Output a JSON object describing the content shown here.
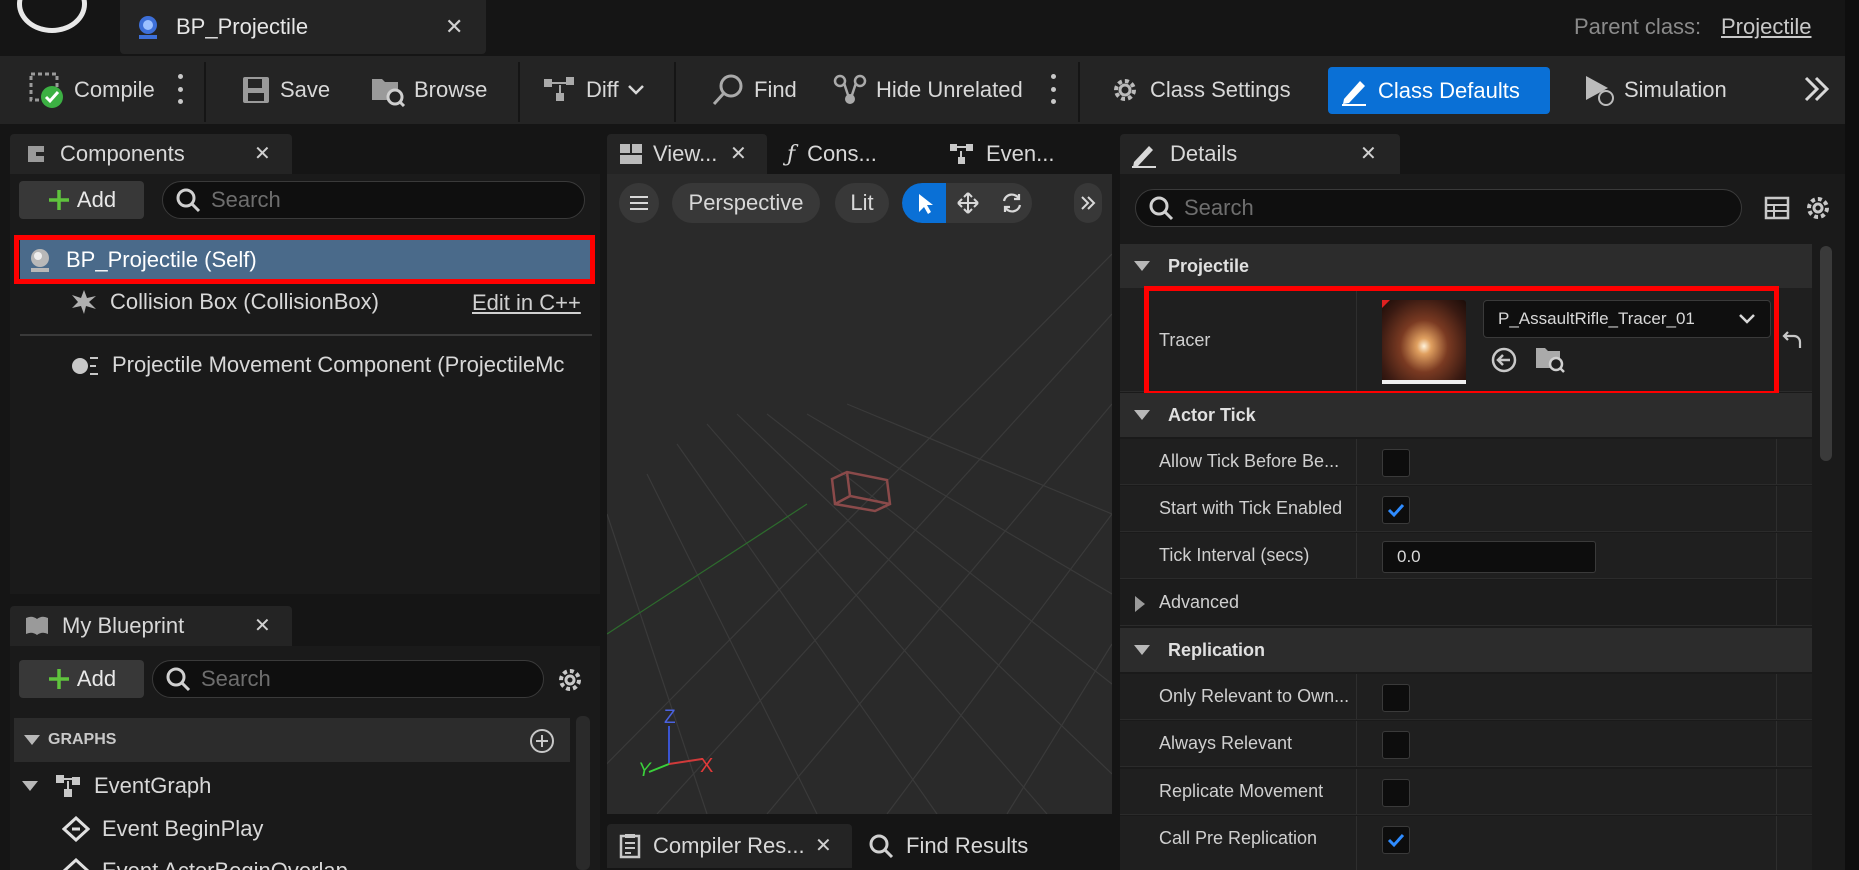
{
  "asset_tab": {
    "title": "BP_Projectile"
  },
  "parent_class": {
    "label": "Parent class:",
    "value": "Projectile"
  },
  "toolbar": {
    "compile": "Compile",
    "save": "Save",
    "browse": "Browse",
    "diff": "Diff",
    "find": "Find",
    "hide_unrelated": "Hide Unrelated",
    "class_settings": "Class Settings",
    "class_defaults": "Class Defaults",
    "simulation": "Simulation"
  },
  "components_panel": {
    "title": "Components",
    "add_label": "Add",
    "search_placeholder": "Search",
    "items": [
      {
        "label": "BP_Projectile (Self)"
      },
      {
        "label": "Collision Box (CollisionBox)",
        "action": "Edit in C++"
      },
      {
        "label": "Projectile Movement Component (ProjectileMc"
      }
    ]
  },
  "my_blueprint": {
    "title": "My Blueprint",
    "add_label": "Add",
    "search_placeholder": "Search",
    "graphs_header": "GRAPHS",
    "graph_items": [
      "EventGraph",
      "Event BeginPlay",
      "Event ActorBeginOverlap"
    ]
  },
  "center_tabs": [
    "View...",
    "Cons...",
    "Even..."
  ],
  "viewport": {
    "perspective": "Perspective",
    "lit": "Lit",
    "axis_x": "X",
    "axis_y": "Y",
    "axis_z": "Z"
  },
  "bottom_tabs": [
    "Compiler Res...",
    "Find Results"
  ],
  "details": {
    "title": "Details",
    "search_placeholder": "Search",
    "sections": {
      "projectile": "Projectile",
      "actor_tick": "Actor Tick",
      "advanced": "Advanced",
      "replication": "Replication"
    },
    "tracer_label": "Tracer",
    "tracer_asset": "P_AssaultRifle_Tracer_01",
    "allow_tick": "Allow Tick Before Be...",
    "start_tick": "Start with Tick Enabled",
    "tick_interval": "Tick Interval (secs)",
    "tick_interval_value": "0.0",
    "only_relevant": "Only Relevant to Own...",
    "always_relevant": "Always Relevant",
    "replicate_movement": "Replicate Movement",
    "call_pre_replication": "Call Pre Replication"
  },
  "colors": {
    "accent": "#0a70d6",
    "highlight": "#ff0000",
    "selected_row": "#4a6a8a"
  }
}
